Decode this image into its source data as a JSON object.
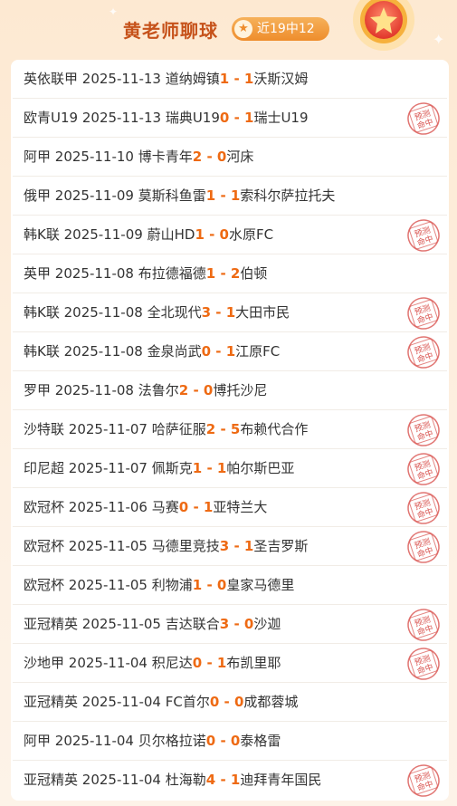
{
  "header": {
    "title": "黄老师聊球",
    "badge_text": "近19中12",
    "badge_icon": "star-icon"
  },
  "stamp_text": {
    "line1": "预测",
    "line2": "命中"
  },
  "colors": {
    "accent": "#ee6a13",
    "title": "#c6521a",
    "stamp": "#d9534f"
  },
  "matches": [
    {
      "league": "英依联甲",
      "date": "2025-11-13",
      "home": "道纳姆镇",
      "home_score": "1",
      "away_score": "1",
      "away": "沃斯汉姆",
      "hit": false
    },
    {
      "league": "欧青U19",
      "date": "2025-11-13",
      "home": "瑞典U19",
      "home_score": "0",
      "away_score": "1",
      "away": "瑞士U19",
      "hit": true
    },
    {
      "league": "阿甲",
      "date": "2025-11-10",
      "home": "博卡青年",
      "home_score": "2",
      "away_score": "0",
      "away": "河床",
      "hit": false
    },
    {
      "league": "俄甲",
      "date": "2025-11-09",
      "home": "莫斯科鱼雷",
      "home_score": "1",
      "away_score": "1",
      "away": "索科尔萨拉托夫",
      "hit": false
    },
    {
      "league": "韩K联",
      "date": "2025-11-09",
      "home": "蔚山HD",
      "home_score": "1",
      "away_score": "0",
      "away": "水原FC",
      "hit": true
    },
    {
      "league": "英甲",
      "date": "2025-11-08",
      "home": "布拉德福德",
      "home_score": "1",
      "away_score": "2",
      "away": "伯顿",
      "hit": false
    },
    {
      "league": "韩K联",
      "date": "2025-11-08",
      "home": "全北现代",
      "home_score": "3",
      "away_score": "1",
      "away": "大田市民",
      "hit": true
    },
    {
      "league": "韩K联",
      "date": "2025-11-08",
      "home": "金泉尚武",
      "home_score": "0",
      "away_score": "1",
      "away": "江原FC",
      "hit": true
    },
    {
      "league": "罗甲",
      "date": "2025-11-08",
      "home": "法鲁尔",
      "home_score": "2",
      "away_score": "0",
      "away": "博托沙尼",
      "hit": false
    },
    {
      "league": "沙特联",
      "date": "2025-11-07",
      "home": "哈萨征服",
      "home_score": "2",
      "away_score": "5",
      "away": "布赖代合作",
      "hit": true
    },
    {
      "league": "印尼超",
      "date": "2025-11-07",
      "home": "佩斯克",
      "home_score": "1",
      "away_score": "1",
      "away": "帕尔斯巴亚",
      "hit": true
    },
    {
      "league": "欧冠杯",
      "date": "2025-11-06",
      "home": "马赛",
      "home_score": "0",
      "away_score": "1",
      "away": "亚特兰大",
      "hit": true
    },
    {
      "league": "欧冠杯",
      "date": "2025-11-05",
      "home": "马德里竞技",
      "home_score": "3",
      "away_score": "1",
      "away": "圣吉罗斯",
      "hit": true
    },
    {
      "league": "欧冠杯",
      "date": "2025-11-05",
      "home": "利物浦",
      "home_score": "1",
      "away_score": "0",
      "away": "皇家马德里",
      "hit": false
    },
    {
      "league": "亚冠精英",
      "date": "2025-11-05",
      "home": "吉达联合",
      "home_score": "3",
      "away_score": "0",
      "away": "沙迦",
      "hit": true
    },
    {
      "league": "沙地甲",
      "date": "2025-11-04",
      "home": "积尼达",
      "home_score": "0",
      "away_score": "1",
      "away": "布凯里耶",
      "hit": true
    },
    {
      "league": "亚冠精英",
      "date": "2025-11-04",
      "home": "FC首尔",
      "home_score": "0",
      "away_score": "0",
      "away": "成都蓉城",
      "hit": false
    },
    {
      "league": "阿甲",
      "date": "2025-11-04",
      "home": "贝尔格拉诺",
      "home_score": "0",
      "away_score": "0",
      "away": "泰格雷",
      "hit": false
    },
    {
      "league": "亚冠精英",
      "date": "2025-11-04",
      "home": "杜海勒",
      "home_score": "4",
      "away_score": "1",
      "away": "迪拜青年国民",
      "hit": true
    }
  ]
}
